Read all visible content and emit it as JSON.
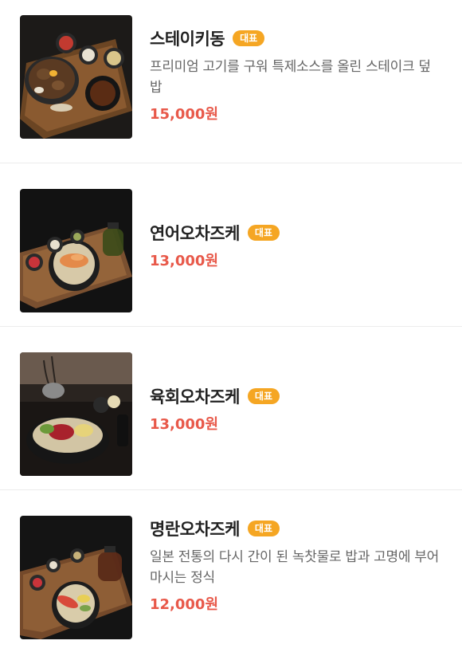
{
  "colors": {
    "badge_bg": "#f5a623",
    "price": "#e8594a",
    "title": "#222222",
    "description": "#666666",
    "divider": "#ececec"
  },
  "menu": [
    {
      "name": "스테이키동",
      "badge": "대표",
      "description": "프리미엄 고기를 구워 특제소스를 올린 스테이크 덮밥",
      "price": "15,000원",
      "photo": "steak-rice-bowl-photo"
    },
    {
      "name": "연어오차즈케",
      "badge": "대표",
      "description": "",
      "price": "13,000원",
      "photo": "salmon-ochazuke-photo"
    },
    {
      "name": "육회오차즈케",
      "badge": "대표",
      "description": "",
      "price": "13,000원",
      "photo": "yukhoe-ochazuke-photo"
    },
    {
      "name": "명란오차즈케",
      "badge": "대표",
      "description": "일본 전통의 다시 간이 된 녹찻물로 밥과 고명에 부어마시는 정식",
      "price": "12,000원",
      "photo": "mentaiko-ochazuke-photo"
    }
  ]
}
